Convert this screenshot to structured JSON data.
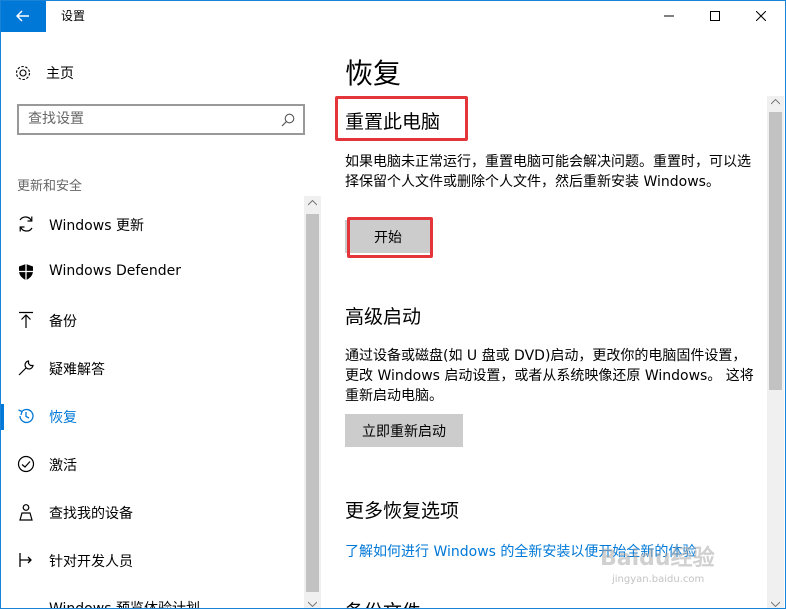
{
  "window": {
    "title": "设置"
  },
  "nav": {
    "home_label": "主页",
    "search_placeholder": "查找设置",
    "section_label": "更新和安全",
    "items": [
      {
        "label": "Windows 更新",
        "icon": "refresh-icon"
      },
      {
        "label": "Windows Defender",
        "icon": "shield-icon"
      },
      {
        "label": "备份",
        "icon": "backup-arrow-icon"
      },
      {
        "label": "疑难解答",
        "icon": "wrench-icon"
      },
      {
        "label": "恢复",
        "icon": "history-icon",
        "active": true
      },
      {
        "label": "激活",
        "icon": "check-circle-icon"
      },
      {
        "label": "查找我的设备",
        "icon": "person-location-icon"
      },
      {
        "label": "针对开发人员",
        "icon": "developer-icon"
      }
    ],
    "cutoff_item": "Windows 预览体验计划"
  },
  "main": {
    "title": "恢复",
    "reset": {
      "heading": "重置此电脑",
      "description": "如果电脑未正常运行，重置电脑可能会解决问题。重置时，可以选择保留个人文件或删除个人文件，然后重新安装 Windows。",
      "button": "开始"
    },
    "advanced": {
      "heading": "高级启动",
      "description": "通过设备或磁盘(如 U 盘或 DVD)启动，更改你的电脑固件设置，更改 Windows 启动设置，或者从系统映像还原 Windows。 这将重新启动电脑。",
      "button": "立即重新启动"
    },
    "more": {
      "heading": "更多恢复选项",
      "link": "了解如何进行 Windows 的全新安装以便开始全新的体验"
    },
    "cutoff_heading": "备份文件"
  },
  "watermark": {
    "text": "Baidu经验",
    "url": "jingyan.baidu.com"
  },
  "colors": {
    "accent": "#0078d7",
    "highlight": "#e4353b",
    "button_bg": "#cccccc"
  }
}
